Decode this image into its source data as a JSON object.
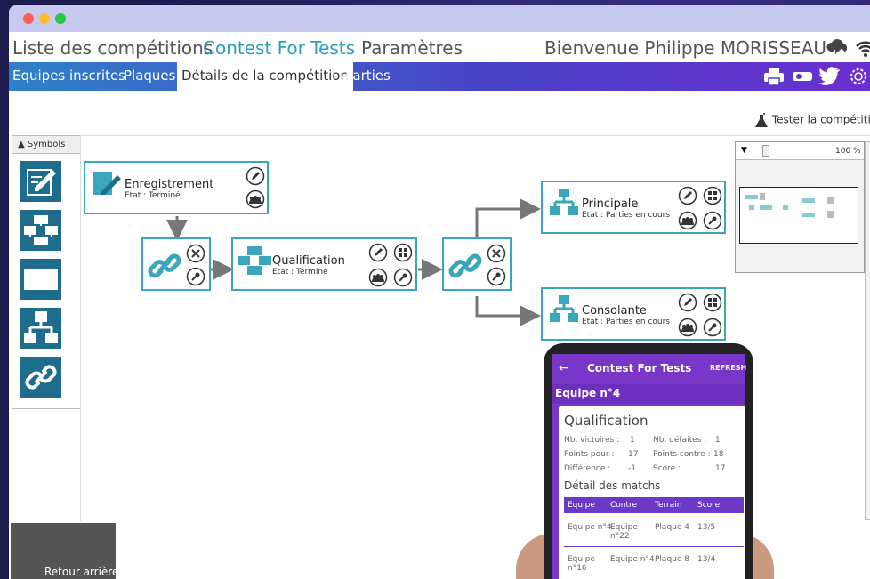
{
  "topnav": {
    "competitions": "Liste des compétitions",
    "contest": "Contest For Tests",
    "params": "Paramètres",
    "welcome": "Bienvenue Philippe MORISSEAU !"
  },
  "menu": {
    "equipes": "Equipes inscrites",
    "plaques": "Plaques",
    "details": "Détails de la compétition",
    "parties": "Parties"
  },
  "tester": "Tester la compétition",
  "palette": {
    "header": "Symbols"
  },
  "nodes": {
    "enreg": {
      "title": "Enregistrement",
      "state": "Etat : Terminé"
    },
    "qualif": {
      "title": "Qualification",
      "state": "Etat : Terminé"
    },
    "principale": {
      "title": "Principale",
      "state": "Etat : Parties en cours"
    },
    "consolante": {
      "title": "Consolante",
      "state": "Etat : Parties en cours"
    }
  },
  "overview": {
    "zoom": "100 %"
  },
  "retour": "Retour arrière",
  "phone": {
    "title": "Contest For Tests",
    "refresh": "REFRESH",
    "team": "Equipe n°4",
    "section": "Qualification",
    "stats": [
      {
        "l1": "Nb. victoires :",
        "v1": "1",
        "l2": "Nb. défaites :",
        "v2": "1"
      },
      {
        "l1": "Points pour :",
        "v1": "17",
        "l2": "Points contre :",
        "v2": "18"
      },
      {
        "l1": "Différence :",
        "v1": "-1",
        "l2": "Score :",
        "v2": "17"
      }
    ],
    "detail": "Détail des matchs",
    "headers": [
      "Equipe",
      "Contre",
      "Terrain",
      "Score"
    ],
    "rows": [
      {
        "equipe": "Equipe n°4",
        "contre": "Equipe n°22",
        "terrain": "Plaque 4",
        "score": "13/5"
      },
      {
        "equipe": "Equipe n°16",
        "contre": "Equipe n°4",
        "terrain": "Plaque 8",
        "score": "13/4"
      }
    ]
  },
  "colors": {
    "accent": "#3aa6b9",
    "menu_start": "#2f80c8",
    "menu_end": "#6a2fd0",
    "phone": "#7a35c9"
  }
}
